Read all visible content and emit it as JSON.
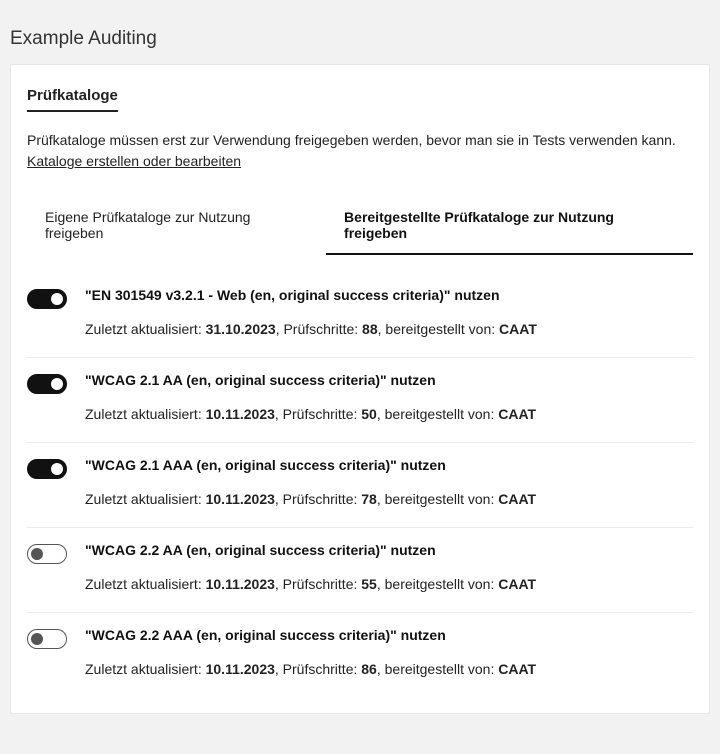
{
  "header": {
    "title": "Example Auditing"
  },
  "panel": {
    "tab_label": "Prüfkataloge",
    "intro": "Prüfkataloge müssen erst zur Verwendung freigegeben werden, bevor man sie in Tests verwenden kann.",
    "link": "Kataloge erstellen oder bearbeiten"
  },
  "sub_tabs": {
    "own": "Eigene Prüfkataloge zur Nutzung freigeben",
    "provided": "Bereitgestellte Prüfkataloge zur Nutzung freigeben"
  },
  "meta_labels": {
    "last_updated": "Zuletzt aktualisiert: ",
    "steps": ", Prüfschritte: ",
    "provided_by": ", bereitgestellt von: "
  },
  "catalogs": [
    {
      "enabled": true,
      "title": "\"EN 301549 v3.2.1 - Web (en, original success criteria)\" nutzen",
      "date": "31.10.2023",
      "steps": "88",
      "provider": "CAAT"
    },
    {
      "enabled": true,
      "title": "\"WCAG 2.1 AA (en, original success criteria)\" nutzen",
      "date": "10.11.2023",
      "steps": "50",
      "provider": "CAAT"
    },
    {
      "enabled": true,
      "title": "\"WCAG 2.1 AAA (en, original success criteria)\" nutzen",
      "date": "10.11.2023",
      "steps": "78",
      "provider": "CAAT"
    },
    {
      "enabled": false,
      "title": "\"WCAG 2.2 AA (en, original success criteria)\" nutzen",
      "date": "10.11.2023",
      "steps": "55",
      "provider": "CAAT"
    },
    {
      "enabled": false,
      "title": "\"WCAG 2.2 AAA (en, original success criteria)\" nutzen",
      "date": "10.11.2023",
      "steps": "86",
      "provider": "CAAT"
    }
  ]
}
